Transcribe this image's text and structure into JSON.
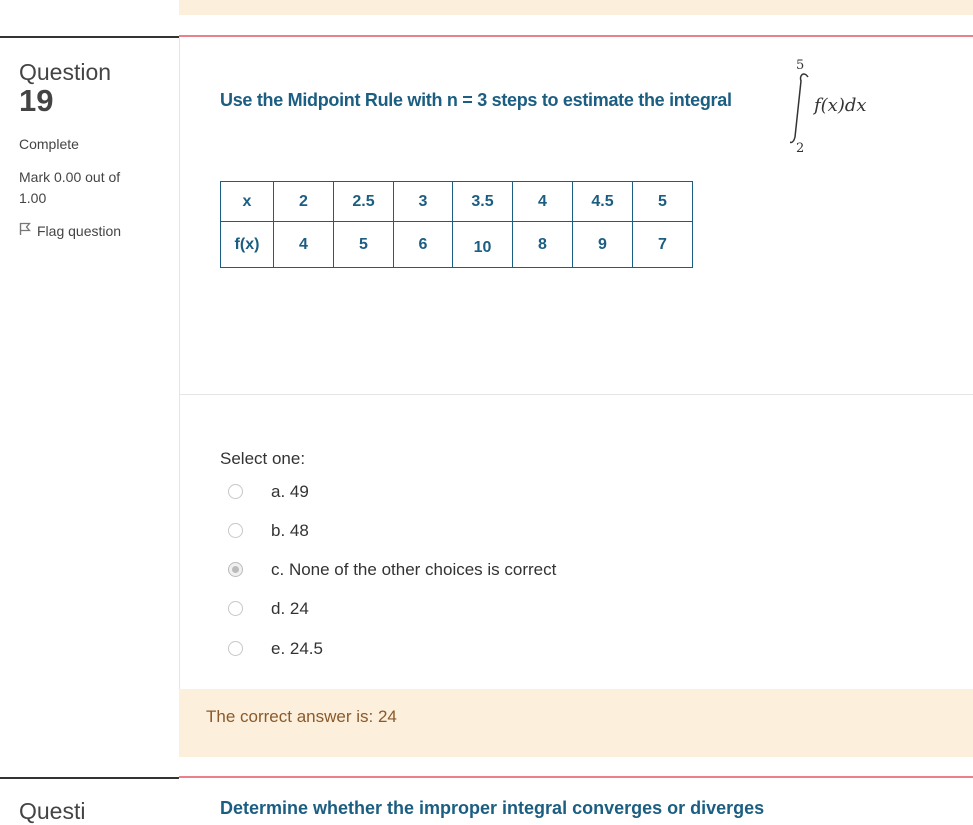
{
  "question": {
    "label": "Question",
    "number": "19",
    "state": "Complete",
    "grade": "Mark 0.00 out of 1.00",
    "flag_label": "Flag question",
    "text": "Use the Midpoint Rule with n = 3 steps to estimate the integral",
    "integral": {
      "upper": "5",
      "lower": "2",
      "integrand": "f(x)dx"
    }
  },
  "table": {
    "header_row": [
      "x",
      "2",
      "2.5",
      "3",
      "3.5",
      "4",
      "4.5",
      "5"
    ],
    "value_row": [
      "f(x)",
      "4",
      "5",
      "6",
      "10",
      "8",
      "9",
      "7"
    ]
  },
  "answer_block": {
    "prompt": "Select one:",
    "options": [
      {
        "label": "a. 49",
        "selected": false
      },
      {
        "label": "b. 48",
        "selected": false
      },
      {
        "label": "c. None of the other choices is correct",
        "selected": true
      },
      {
        "label": "d. 24",
        "selected": false
      },
      {
        "label": "e. 24.5",
        "selected": false
      }
    ],
    "correct_answer": "The correct answer is: 24"
  },
  "next_question": {
    "label_partial": "Questi",
    "text_partial": "Determine whether the improper integral converges or diverges"
  },
  "colors": {
    "question_text": "#1b5e82",
    "separator_accent": "#e8818c",
    "feedback_bg": "#fcefdc",
    "feedback_text": "#8a5a2b"
  }
}
